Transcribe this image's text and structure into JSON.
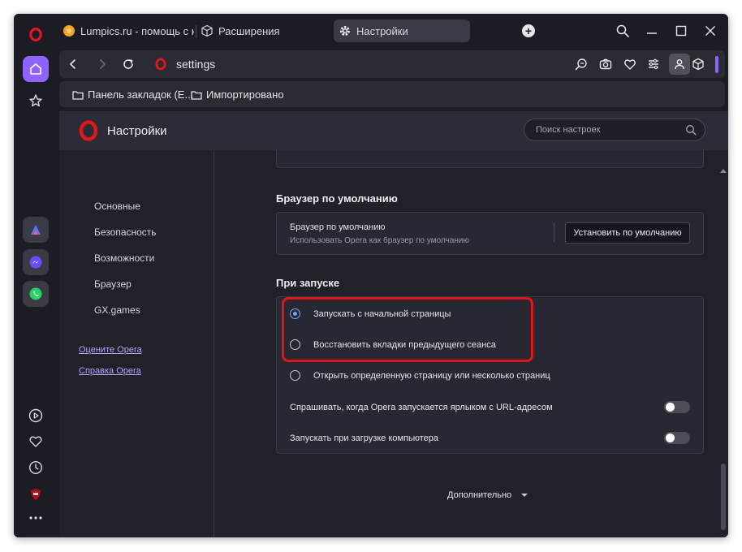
{
  "tabs": [
    {
      "label": "Lumpics.ru - помощь с ко",
      "icon": "lumpics-favicon-icon"
    },
    {
      "label": "Расширения",
      "icon": "cube-icon"
    },
    {
      "label": "Настройки",
      "icon": "gear-icon",
      "active": true
    }
  ],
  "address": {
    "url": "settings"
  },
  "bookmarks": [
    {
      "label": "Панель закладок (E..."
    },
    {
      "label": "Импортировано"
    }
  ],
  "header": {
    "title": "Настройки",
    "search_placeholder": "Поиск настроек"
  },
  "sidebar": {
    "items": [
      "Основные",
      "Безопасность",
      "Возможности",
      "Браузер",
      "GX.games"
    ],
    "links": [
      "Оцените Opera",
      "Справка Opera"
    ]
  },
  "default_browser": {
    "section_title": "Браузер по умолчанию",
    "title": "Браузер по умолчанию",
    "subtitle": "Использовать Opera как браузер по умолчанию",
    "button": "Установить по умолчанию"
  },
  "startup": {
    "section_title": "При запуске",
    "options": [
      {
        "label": "Запускать с начальной страницы",
        "selected": true
      },
      {
        "label": "Восстановить вкладки предыдущего сеанса",
        "selected": false
      },
      {
        "label": "Открыть определенную страницу или несколько страниц",
        "selected": false
      }
    ],
    "toggles": [
      {
        "label": "Спрашивать, когда Opera запускается ярлыком с URL-адресом",
        "on": false
      },
      {
        "label": "Запускать при загрузке компьютера",
        "on": false
      }
    ]
  },
  "more_label": "Дополнительно",
  "colors": {
    "opera_red": "#e0161c",
    "accent": "#6ea8ff",
    "highlight": "#e0161c",
    "home_active": "#8e63ff"
  }
}
